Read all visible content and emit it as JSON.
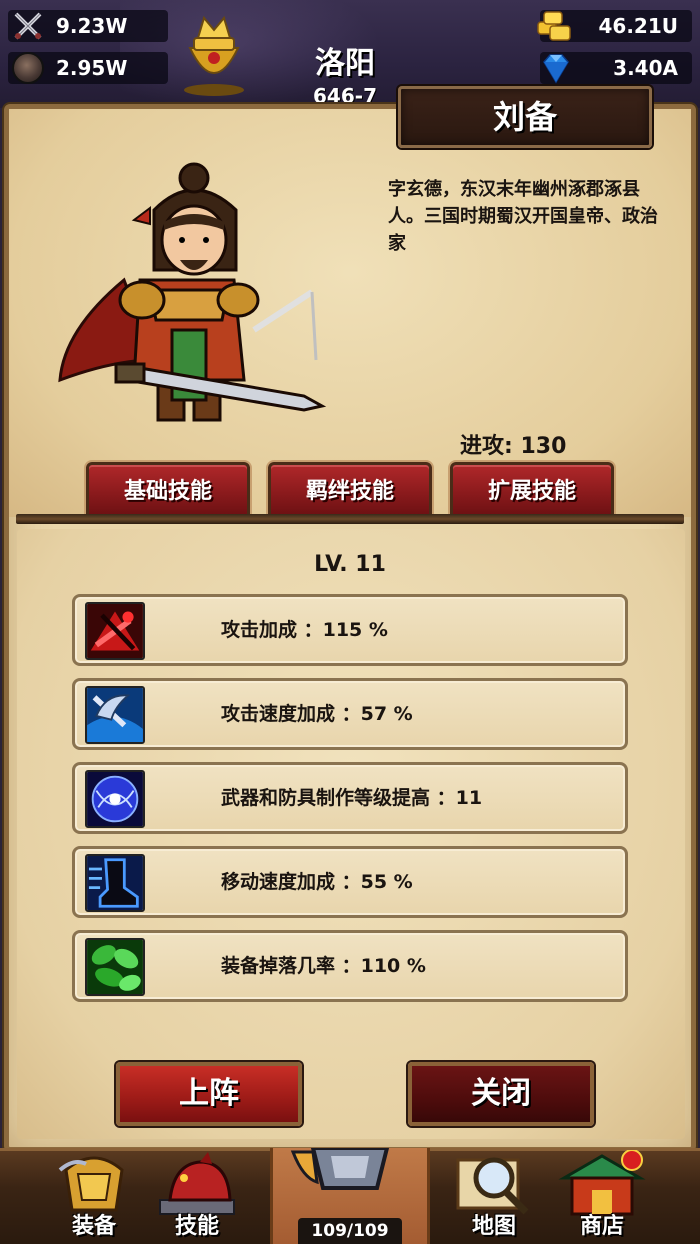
{
  "resources": {
    "attack": "9.23W",
    "defense": "2.95W",
    "gold": "46.21U",
    "gems": "3.40A"
  },
  "location": {
    "city": "洛阳",
    "coords": "646-7"
  },
  "hero": {
    "name": "刘备",
    "bio": "字玄德，东汉末年幽州涿郡涿县人。三国时期蜀汉开国皇帝、政治家",
    "attack_stat": "进攻: 130"
  },
  "tabs": [
    {
      "label": "基础技能"
    },
    {
      "label": "羁绊技能"
    },
    {
      "label": "扩展技能"
    }
  ],
  "skills": {
    "level": "LV. 11",
    "items": [
      {
        "text": "攻击加成 ：115 %",
        "icon": "attack-bonus-icon"
      },
      {
        "text": "攻击速度加成 ：57 %",
        "icon": "attack-speed-icon"
      },
      {
        "text": "武器和防具制作等级提高 ：11",
        "icon": "crafting-level-icon"
      },
      {
        "text": "移动速度加成 ：55 %",
        "icon": "move-speed-icon"
      },
      {
        "text": "装备掉落几率 ：110 %",
        "icon": "drop-rate-icon"
      }
    ]
  },
  "buttons": {
    "deploy": "上阵",
    "close": "关闭"
  },
  "bottom_nav": {
    "equip": "装备",
    "skills": "技能",
    "map": "地图",
    "shop": "商店",
    "count": "109/109"
  },
  "colors": {
    "parchment": "#e9d6aa",
    "tab_red": "#b0282a",
    "name_plate": "#2a1810"
  }
}
